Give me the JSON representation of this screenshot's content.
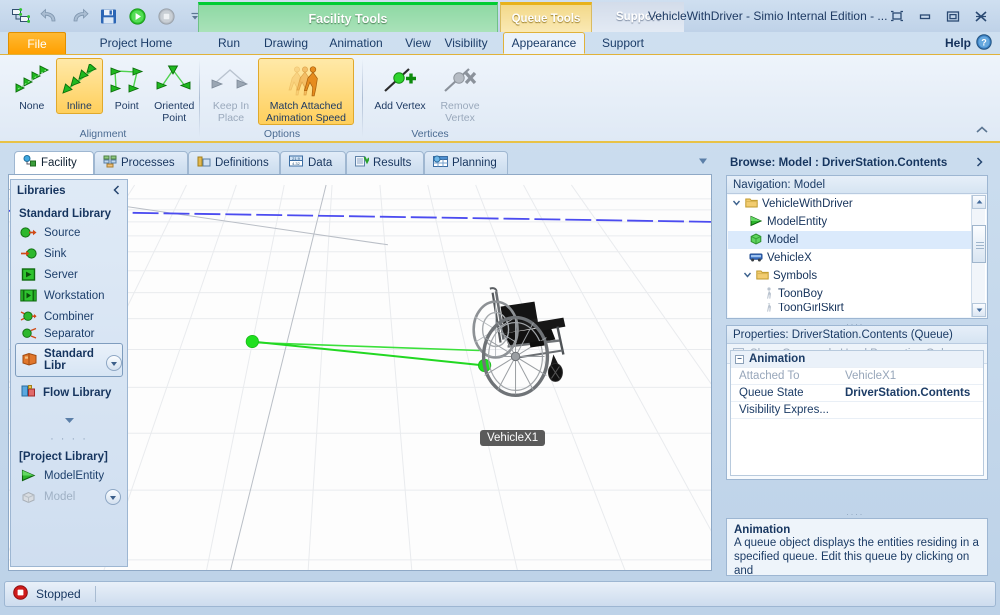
{
  "window": {
    "title": "VehicleWithDriver - Simio Internal Edition - ...",
    "controls": {
      "restore_label": "⧉",
      "minimize_label": "—",
      "maximize_label": "❐",
      "close_label": "✕"
    }
  },
  "quick_access": {
    "items": [
      {
        "name": "simio-logo-icon",
        "label": "Simio"
      },
      {
        "name": "undo-icon",
        "label": "Undo"
      },
      {
        "name": "redo-icon",
        "label": "Redo"
      },
      {
        "name": "save-icon",
        "label": "Save"
      },
      {
        "name": "run-icon",
        "label": "Run"
      },
      {
        "name": "stop-icon",
        "label": "Stop"
      },
      {
        "name": "qat-dropdown-icon",
        "label": "Customize Quick Access Toolbar"
      }
    ]
  },
  "context_headers": {
    "facility_tools": "Facility Tools",
    "queue_tools": "Queue Tools",
    "support_group": "Support"
  },
  "ribbon": {
    "tabs": [
      {
        "label": "File",
        "kind": "file"
      },
      {
        "label": "Project Home",
        "kind": "normal"
      },
      {
        "label": "Run",
        "kind": "normal"
      },
      {
        "label": "Drawing",
        "kind": "normal"
      },
      {
        "label": "Animation",
        "kind": "normal"
      },
      {
        "label": "View",
        "kind": "normal"
      },
      {
        "label": "Visibility",
        "kind": "normal"
      },
      {
        "label": "Appearance",
        "kind": "active"
      },
      {
        "label": "Support",
        "kind": "normal"
      }
    ],
    "help_label": "Help",
    "groups": [
      {
        "title": "Alignment",
        "buttons": [
          {
            "label": "None",
            "icon": "align-none-icon",
            "state": "normal"
          },
          {
            "label": "Inline",
            "icon": "align-inline-icon",
            "state": "selected"
          },
          {
            "label": "Point",
            "icon": "align-point-icon",
            "state": "normal"
          },
          {
            "label": "Oriented Point",
            "icon": "align-oriented-point-icon",
            "state": "normal"
          }
        ]
      },
      {
        "title": "Options",
        "buttons": [
          {
            "label": "Keep In Place",
            "icon": "keep-in-place-icon",
            "state": "disabled"
          },
          {
            "label": "Match Attached Animation Speed",
            "icon": "match-animation-speed-icon",
            "state": "selected"
          }
        ]
      },
      {
        "title": "Vertices",
        "buttons": [
          {
            "label": "Add Vertex",
            "icon": "add-vertex-icon",
            "state": "normal"
          },
          {
            "label": "Remove Vertex",
            "icon": "remove-vertex-icon",
            "state": "disabled"
          }
        ]
      }
    ]
  },
  "project_tabs": [
    {
      "label": "Facility",
      "icon": "facility-icon",
      "active": true
    },
    {
      "label": "Processes",
      "icon": "processes-icon",
      "active": false
    },
    {
      "label": "Definitions",
      "icon": "definitions-icon",
      "active": false
    },
    {
      "label": "Data",
      "icon": "data-icon",
      "active": false
    },
    {
      "label": "Results",
      "icon": "results-icon",
      "active": false
    },
    {
      "label": "Planning",
      "icon": "planning-icon",
      "active": false
    }
  ],
  "libraries": {
    "header": "Libraries",
    "collapse_icon": "chevron-left-icon",
    "standard_library_title": "Standard Library",
    "standard_items": [
      {
        "label": "Source",
        "icon": "source-icon"
      },
      {
        "label": "Sink",
        "icon": "sink-icon"
      },
      {
        "label": "Server",
        "icon": "server-icon"
      },
      {
        "label": "Workstation",
        "icon": "workstation-icon"
      },
      {
        "label": "Combiner",
        "icon": "combiner-icon"
      },
      {
        "label": "Separator",
        "icon": "separator-icon"
      }
    ],
    "group_buttons": [
      {
        "label": "Standard Libr",
        "icon": "standard-library-icon",
        "selected": true
      },
      {
        "label": "Flow Library",
        "icon": "flow-library-icon",
        "selected": false
      }
    ],
    "more_icon": "chevron-down-icon",
    "dots": "· · · ·",
    "project_library_title": "[Project Library]",
    "project_items": [
      {
        "label": "ModelEntity",
        "icon": "model-entity-icon",
        "dim": false
      },
      {
        "label": "Model",
        "icon": "model-icon",
        "dim": true
      }
    ]
  },
  "canvas": {
    "vehicle_label": "VehicleX1",
    "horizon_color": "#4b4bf0",
    "path_color": "#22dd22",
    "node_color": "#19e019"
  },
  "browse": {
    "header": "Browse: Model : DriverStation.Contents",
    "expand_icon": "chevron-right-icon",
    "nav_caption": "Navigation: Model",
    "tree": [
      {
        "label": "VehicleWithDriver",
        "icon": "folder-icon",
        "indent": 0,
        "expander": "▾",
        "selected": false
      },
      {
        "label": "ModelEntity",
        "icon": "model-entity-icon",
        "indent": 1,
        "expander": "",
        "selected": false
      },
      {
        "label": "Model",
        "icon": "model-sphere-icon",
        "indent": 1,
        "expander": "",
        "selected": true
      },
      {
        "label": "VehicleX",
        "icon": "vehicle-icon",
        "indent": 1,
        "expander": "",
        "selected": false
      },
      {
        "label": "Symbols",
        "icon": "folder-icon",
        "indent": 1,
        "expander": "▾",
        "selected": false
      },
      {
        "label": "ToonBoy",
        "icon": "symbol-icon",
        "indent": 2,
        "expander": "",
        "selected": false
      },
      {
        "label": "ToonGirlSkirt",
        "icon": "symbol-icon",
        "indent": 2,
        "expander": "",
        "selected": false
      }
    ]
  },
  "properties": {
    "header": "Properties: DriverStation.Contents (Queue)",
    "show_common_label": "Show Commonly Used Properties Only",
    "category": "Animation",
    "rows": [
      {
        "key": "Attached To",
        "value": "VehicleX1",
        "dim": true,
        "bold": false
      },
      {
        "key": "Queue State",
        "value": "DriverStation.Contents",
        "dim": false,
        "bold": true
      },
      {
        "key": "Visibility Expres...",
        "value": "",
        "dim": false,
        "bold": false
      }
    ]
  },
  "help_pane": {
    "title": "Animation",
    "body": "A queue object displays the entities residing in a specified queue. Edit this queue by clicking on and"
  },
  "status": {
    "icon": "stopped-icon",
    "text": "Stopped"
  }
}
